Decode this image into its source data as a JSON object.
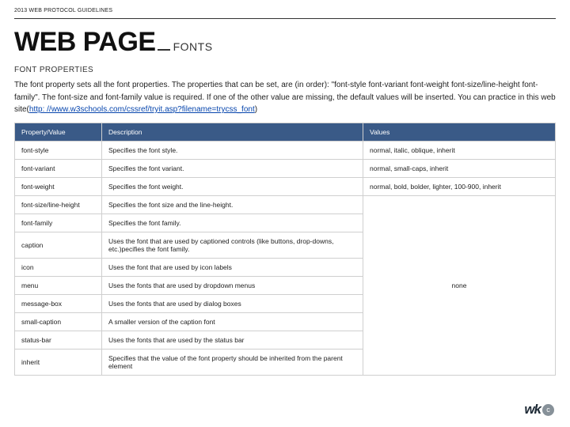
{
  "header": {
    "topline": "2013 WEB PROTOCOL GUIDELINES",
    "title_main": "WEB PAGE",
    "title_sub": "FONTS"
  },
  "section": {
    "heading": "FONT PROPERTIES",
    "intro_pre": "The font property sets all the font properties. The properties that can be set, are (in order): \"font-style font-variant font-weight font-size/line-height font-family\". The font-size and font-family value is required. If one of the other value are missing, the default values will be inserted. You can practice in this web site(",
    "link_text": "http: //www.w3schools.com/cssref/tryit.asp?filename=trycss_font",
    "intro_post": ")"
  },
  "table": {
    "headers": [
      "Property/Value",
      "Description",
      "Values"
    ],
    "rows": [
      {
        "prop": "font-style",
        "desc": "Specifies the font style.",
        "values": "normal, italic, oblique, inherit"
      },
      {
        "prop": "font-variant",
        "desc": "Specifies the font variant.",
        "values": "normal, small-caps, inherit"
      },
      {
        "prop": "font-weight",
        "desc": "Specifies the font weight.",
        "values": "normal, bold, bolder, lighter, 100-900, inherit"
      },
      {
        "prop": "font-size/line-height",
        "desc": "Specifies the font size and the line-height."
      },
      {
        "prop": "font-family",
        "desc": "Specifies the font family."
      },
      {
        "prop": "caption",
        "desc": "Uses the font that are used by captioned controls (like buttons, drop-downs, etc.)pecifies the font family."
      },
      {
        "prop": "icon",
        "desc": "Uses the font that are used by icon labels"
      },
      {
        "prop": "menu",
        "desc": "Uses the fonts that are used by dropdown menus"
      },
      {
        "prop": "message-box",
        "desc": "Uses the fonts that are used by dialog boxes"
      },
      {
        "prop": "small-caption",
        "desc": "A smaller version of the caption font"
      },
      {
        "prop": "status-bar",
        "desc": "Uses the fonts that are used by the status bar"
      },
      {
        "prop": "inherit",
        "desc": "Specifies that the value of the font property should be inherited from the parent element"
      }
    ],
    "merged_value": "none"
  },
  "logo": {
    "text": "wk",
    "badge": "c"
  }
}
